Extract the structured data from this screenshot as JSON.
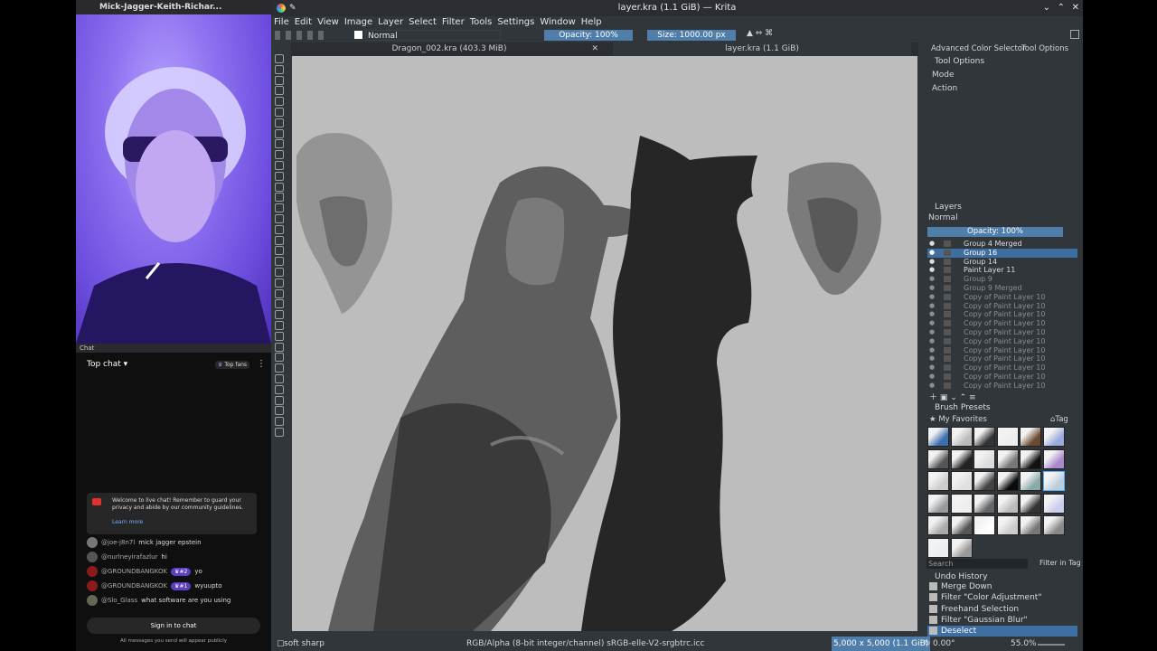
{
  "stream": {
    "window_title": "Mick-Jagger-Keith-Richar...",
    "chat_header": "Chat",
    "top_chat_label": "Top chat",
    "top_fans_label": "Top fans",
    "welcome_text": "Welcome to live chat! Remember to guard your privacy and abide by our community guidelines.",
    "learn_more": "Learn more",
    "messages": [
      {
        "handle": "@joe-j8n7l",
        "rank": "",
        "text": "mick jagger epstein"
      },
      {
        "handle": "@nurlneyirafazlur",
        "rank": "",
        "text": "hi"
      },
      {
        "handle": "@GROUNDBANGKOK",
        "rank": "#2",
        "text": "yo"
      },
      {
        "handle": "@GROUNDBANGKOK",
        "rank": "#1",
        "text": "wyuupto"
      },
      {
        "handle": "@Slo_Glass",
        "rank": "",
        "text": "what software are you using"
      }
    ],
    "sign_in_button": "Sign in to chat",
    "footer_note": "All messages you send will appear publicly"
  },
  "krita": {
    "title": "layer.kra (1.1 GiB) — Krita",
    "menu": [
      "File",
      "Edit",
      "View",
      "Image",
      "Layer",
      "Select",
      "Filter",
      "Tools",
      "Settings",
      "Window",
      "Help"
    ],
    "blend_mode": "Normal",
    "opacity_label": "Opacity: 100%",
    "size_label": "Size: 1000.00 px",
    "tabs": [
      "Dragon_002.kra (403.3 MiB)",
      "layer.kra (1.1 GiB)"
    ],
    "status": {
      "brush": "soft sharp",
      "color_space": "RGB/Alpha (8-bit integer/channel)  sRGB-elle-V2-srgbtrc.icc",
      "dimensions": "5,000 x 5,000 (1.1 GiB)",
      "rotation": "0.00°",
      "zoom": "55.0%"
    },
    "dockers": {
      "top_tabs": [
        "Advanced Color Selector",
        "Tool Options"
      ],
      "tool_options_title": "Tool Options",
      "mode_label": "Mode",
      "action_label": "Action",
      "layers_title": "Layers",
      "layers_blend": "Normal",
      "layers_opacity": "Opacity:  100%",
      "layers": [
        {
          "name": "Group 4 Merged",
          "dim": false,
          "selected": false
        },
        {
          "name": "Group 16",
          "dim": false,
          "selected": true
        },
        {
          "name": "Group 14",
          "dim": false,
          "selected": false
        },
        {
          "name": "Paint Layer 11",
          "dim": false,
          "selected": false
        },
        {
          "name": "Group 9",
          "dim": true,
          "selected": false
        },
        {
          "name": "Group 9 Merged",
          "dim": true,
          "selected": false
        },
        {
          "name": "Copy of Paint Layer 10",
          "dim": true,
          "selected": false
        },
        {
          "name": "Copy of Paint Layer 10",
          "dim": true,
          "selected": false
        },
        {
          "name": "Copy of Paint Layer 10",
          "dim": true,
          "selected": false
        },
        {
          "name": "Copy of Paint Layer 10",
          "dim": true,
          "selected": false
        },
        {
          "name": "Copy of Paint Layer 10",
          "dim": true,
          "selected": false
        },
        {
          "name": "Copy of Paint Layer 10",
          "dim": true,
          "selected": false
        },
        {
          "name": "Copy of Paint Layer 10",
          "dim": true,
          "selected": false
        },
        {
          "name": "Copy of Paint Layer 10",
          "dim": true,
          "selected": false
        },
        {
          "name": "Copy of Paint Layer 10",
          "dim": true,
          "selected": false
        },
        {
          "name": "Copy of Paint Layer 10",
          "dim": true,
          "selected": false
        },
        {
          "name": "Copy of Paint Layer 10",
          "dim": true,
          "selected": false
        }
      ],
      "brush_presets_title": "Brush Presets",
      "brush_tag": "My Favorites",
      "tag_button": "Tag",
      "search_placeholder": "Search",
      "filter_in_tag": "Filter in Tag",
      "undo_title": "Undo History",
      "undo": [
        {
          "name": "Merge Down",
          "selected": false
        },
        {
          "name": "Filter \"Color Adjustment\"",
          "selected": false
        },
        {
          "name": "Freehand Selection",
          "selected": false
        },
        {
          "name": "Filter \"Gaussian Blur\"",
          "selected": false
        },
        {
          "name": "Deselect",
          "selected": true
        }
      ]
    }
  }
}
